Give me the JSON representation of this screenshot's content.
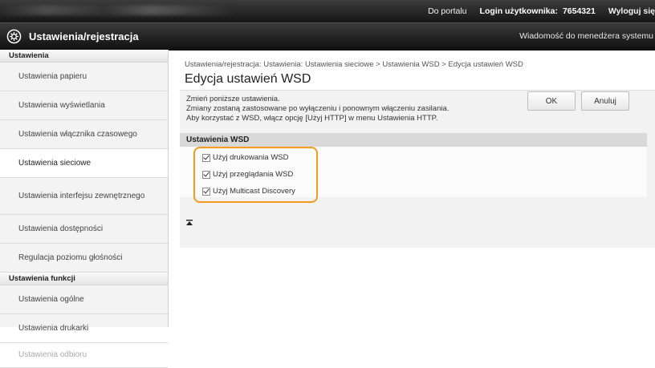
{
  "topbar": {
    "portal_link": "Do portalu",
    "login_label": "Login użytkownika:",
    "login_value": "7654321",
    "logout": "Wyloguj się"
  },
  "titlebar": {
    "app_title": "Ustawienia/rejestracja",
    "message": "Wiadomość do menedżera systemu"
  },
  "sidebar": {
    "header_settings": "Ustawienia",
    "items": [
      "Ustawienia papieru",
      "Ustawienia wyświetlania",
      "Ustawienia włącznika czasowego",
      "Ustawienia sieciowe",
      "Ustawienia interfejsu zewnętrznego",
      "Ustawienia dostępności",
      "Regulacja poziomu głośności"
    ],
    "header_functions": "Ustawienia funkcji",
    "function_items": [
      "Ustawienia ogólne",
      "Ustawienia drukarki",
      "Ustawienia odbioru"
    ]
  },
  "main": {
    "breadcrumb": "Ustawienia/rejestracja: Ustawienia: Ustawienia sieciowe > Ustawienia WSD > Edycja ustawień WSD",
    "title": "Edycja ustawień WSD",
    "desc_line1": "Zmień poniższe ustawienia.",
    "desc_line2": "Zmiany zostaną zastosowane po wyłączeniu i ponownym włączeniu zasilania.",
    "desc_line3": "Aby korzystać z WSD, włącz opcję [Użyj HTTP] w menu Ustawienia HTTP.",
    "ok_button": "OK",
    "cancel_button": "Anuluj",
    "section_title": "Ustawienia WSD",
    "options": [
      {
        "label": "Użyj drukowania WSD",
        "checked": true
      },
      {
        "label": "Użyj przeglądania WSD",
        "checked": true
      },
      {
        "label": "Użyj Multicast Discovery",
        "checked": true
      }
    ]
  },
  "colors": {
    "highlight": "#f39a1f",
    "header_bg": "#1a1a1a",
    "sidebar_bg": "#f3f3f3"
  }
}
